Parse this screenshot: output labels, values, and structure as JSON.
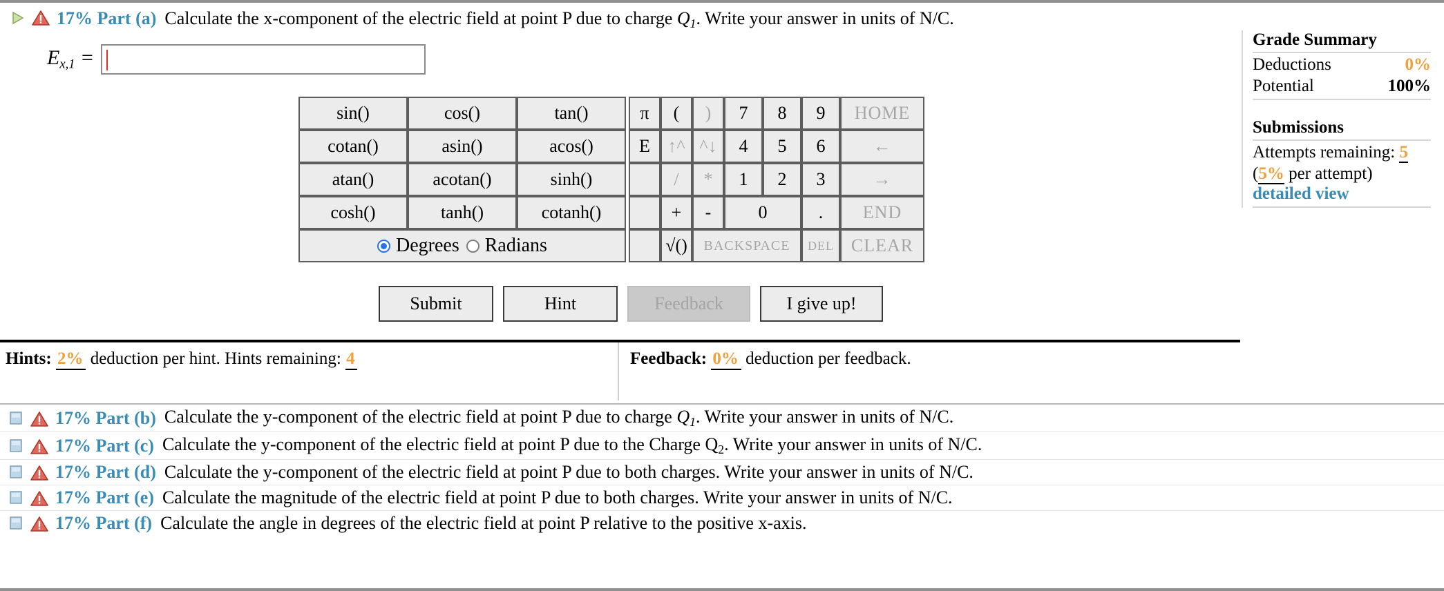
{
  "active_part": {
    "percent": "17%",
    "label": "17% Part (a)",
    "text_before": "Calculate the x-component of the electric field at point P due to charge ",
    "charge": "Q",
    "charge_sub": "1",
    "text_after": ". Write your answer in units of N/C."
  },
  "answer": {
    "label_main": "E",
    "label_sub": "x,1",
    "equals": "=",
    "value": "",
    "placeholder": ""
  },
  "calculator": {
    "functions": [
      [
        "sin()",
        "cos()",
        "tan()"
      ],
      [
        "cotan()",
        "asin()",
        "acos()"
      ],
      [
        "atan()",
        "acotan()",
        "sinh()"
      ],
      [
        "cosh()",
        "tanh()",
        "cotanh()"
      ]
    ],
    "angle_mode": {
      "selected": "Degrees",
      "options": [
        "Degrees",
        "Radians"
      ]
    },
    "col_pi": [
      "π",
      "E",
      "",
      "",
      ""
    ],
    "keys": [
      [
        {
          "l": "(",
          "d": false
        },
        {
          "l": ")",
          "d": true
        },
        {
          "l": "7",
          "d": false
        },
        {
          "l": "8",
          "d": false
        },
        {
          "l": "9",
          "d": false
        },
        {
          "l": "HOME",
          "d": true
        }
      ],
      [
        {
          "l": "↑^",
          "d": true
        },
        {
          "l": "^↓",
          "d": true
        },
        {
          "l": "4",
          "d": false
        },
        {
          "l": "5",
          "d": false
        },
        {
          "l": "6",
          "d": false
        },
        {
          "l": "←",
          "d": true
        }
      ],
      [
        {
          "l": "/",
          "d": true
        },
        {
          "l": "*",
          "d": true
        },
        {
          "l": "1",
          "d": false
        },
        {
          "l": "2",
          "d": false
        },
        {
          "l": "3",
          "d": false
        },
        {
          "l": "→",
          "d": true
        }
      ],
      [
        {
          "l": "+",
          "d": false
        },
        {
          "l": "-",
          "d": false
        },
        {
          "l": "0",
          "d": false
        },
        {
          "l": ".",
          "d": false
        },
        {
          "l": "END",
          "d": true
        }
      ],
      [
        {
          "l": "√()",
          "d": false
        },
        {
          "l": "BACKSPACE",
          "d": true
        },
        {
          "l": "DEL",
          "d": true
        },
        {
          "l": "CLEAR",
          "d": true
        }
      ]
    ]
  },
  "actions": {
    "submit": "Submit",
    "hint": "Hint",
    "feedback": "Feedback",
    "give_up": "I give up!"
  },
  "hints_bar": {
    "hints_title": "Hints:",
    "hints_pct": "2%",
    "hints_text": "deduction per hint. Hints remaining:",
    "hints_remaining": "4",
    "feedback_title": "Feedback:",
    "feedback_pct": "0%",
    "feedback_text": "deduction per feedback."
  },
  "grade_summary": {
    "title": "Grade Summary",
    "deductions_label": "Deductions",
    "deductions_value": "0%",
    "potential_label": "Potential",
    "potential_value": "100%",
    "submissions_title": "Submissions",
    "attempts_label": "Attempts remaining:",
    "attempts_value": "5",
    "per_attempt_open": "(",
    "per_attempt_pct": "5%",
    "per_attempt_text": " per attempt)",
    "detailed_view": "detailed view"
  },
  "other_parts": [
    {
      "label": "17% Part (b)",
      "before": "Calculate the y-component of the electric field at point P due to charge ",
      "charge": "Q",
      "charge_sub": "1",
      "italic": true,
      "after": ". Write your answer in units of N/C."
    },
    {
      "label": "17% Part (c)",
      "before": "Calculate the y-component of the electric field at point P due to the Charge ",
      "charge": "Q",
      "charge_sub": "2",
      "italic": false,
      "after": ". Write your answer in units of N/C."
    },
    {
      "label": "17% Part (d)",
      "before": "Calculate the y-component of the electric field at point P due to both charges. Write your answer in units of N/C.",
      "charge": "",
      "charge_sub": "",
      "italic": false,
      "after": ""
    },
    {
      "label": "17% Part (e)",
      "before": "Calculate the magnitude of the electric field at point P due to both charges. Write your answer in units of N/C.",
      "charge": "",
      "charge_sub": "",
      "italic": false,
      "after": ""
    },
    {
      "label": "17% Part (f)",
      "before": "Calculate the angle in degrees of the electric field at point P relative to the positive x-axis.",
      "charge": "",
      "charge_sub": "",
      "italic": false,
      "after": ""
    }
  ],
  "colors": {
    "part_label_blue": "#3b8cb4",
    "orange": "#f0a03c",
    "warn_red": "#d24a3a",
    "key_bg": "#ececec",
    "key_disabled_bg": "#cbcbcb"
  },
  "icons": {
    "toggle_open": "triangle-right-icon",
    "toggle_closed": "square-icon",
    "warning": "warning-triangle-icon"
  }
}
